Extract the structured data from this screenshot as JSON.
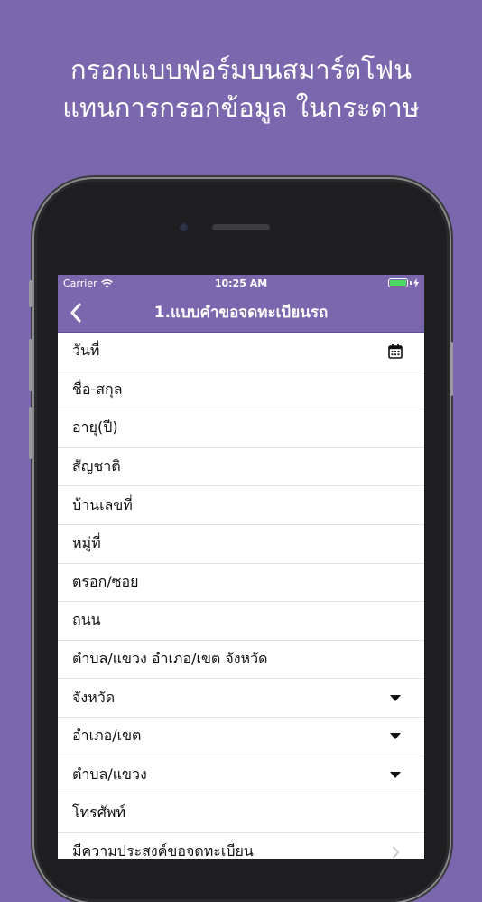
{
  "headline": {
    "line1": "กรอกแบบฟอร์มบนสมาร์ตโฟน",
    "line2": "แทนการกรอกข้อมูล ในกระดาษ"
  },
  "status_bar": {
    "carrier": "Carrier",
    "time": "10:25 AM",
    "battery_level": 1.0
  },
  "nav": {
    "title": "1.แบบคำขอจดทะเบียนรถ",
    "back_icon": "chevron-left-icon"
  },
  "form": {
    "rows": [
      {
        "label": "วันที่",
        "accessory": "calendar-icon"
      },
      {
        "label": "ชื่อ-สกุล",
        "accessory": ""
      },
      {
        "label": "อายุ(ปี)",
        "accessory": ""
      },
      {
        "label": "สัญชาติ",
        "accessory": ""
      },
      {
        "label": "บ้านเลขที่",
        "accessory": ""
      },
      {
        "label": "หมู่ที่",
        "accessory": ""
      },
      {
        "label": "ตรอก/ซอย",
        "accessory": ""
      },
      {
        "label": "ถนน",
        "accessory": ""
      },
      {
        "label": "ตำบล/แขวง อำเภอ/เขต จังหวัด",
        "accessory": ""
      },
      {
        "label": "จังหวัด",
        "accessory": "dropdown-caret-icon"
      },
      {
        "label": "อำเภอ/เขต",
        "accessory": "dropdown-caret-icon"
      },
      {
        "label": "ตำบล/แขวง",
        "accessory": "dropdown-caret-icon"
      },
      {
        "label": "โทรศัพท์",
        "accessory": ""
      },
      {
        "label": "มีความประสงค์ขอจดทะเบียน",
        "accessory": "chevron-right-icon"
      }
    ]
  },
  "colors": {
    "brand": "#7b67ae",
    "background": "#7b67ae",
    "row_divider": "#e2e2e6"
  }
}
